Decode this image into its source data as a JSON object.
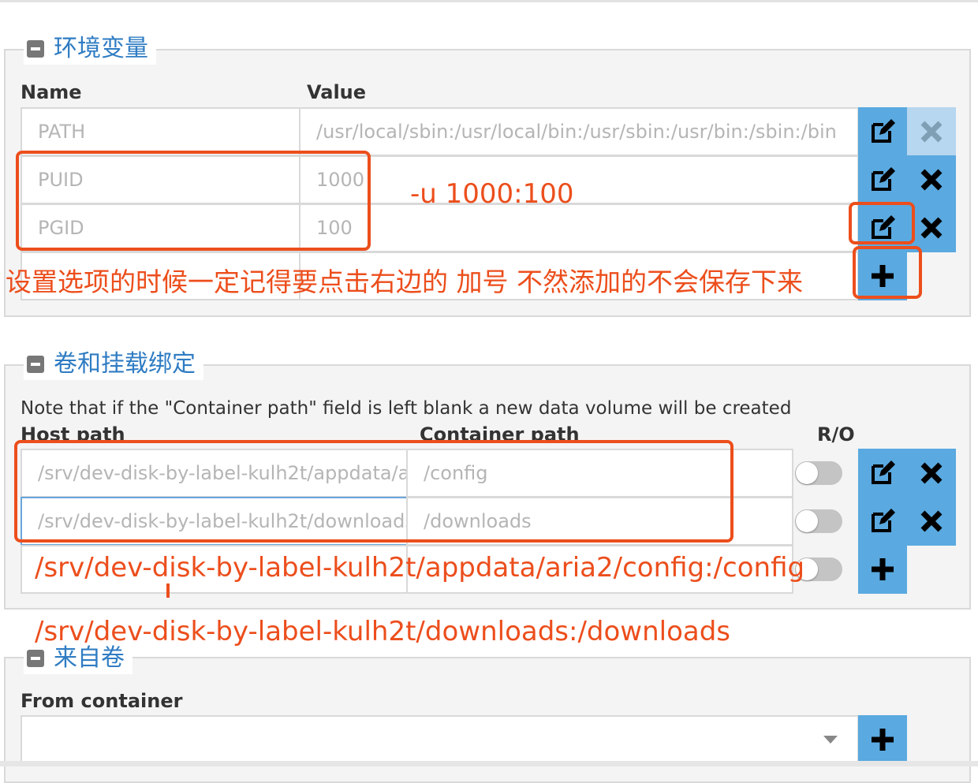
{
  "env_section": {
    "legend": "环境变量",
    "col_name": "Name",
    "col_value": "Value",
    "rows": [
      {
        "name": "PATH",
        "value": "/usr/local/sbin:/usr/local/bin:/usr/sbin:/usr/bin:/sbin:/bin"
      },
      {
        "name": "PUID",
        "value": "1000"
      },
      {
        "name": "PGID",
        "value": "100"
      }
    ]
  },
  "volumes_section": {
    "legend": "卷和挂载绑定",
    "note": "Note that if the \"Container path\" field is left blank a new data volume will be created",
    "col_host": "Host path",
    "col_container": "Container path",
    "col_ro": "R/O",
    "rows": [
      {
        "host": "/srv/dev-disk-by-label-kulh2t/appdata/aria2/config",
        "container": "/config"
      },
      {
        "host": "/srv/dev-disk-by-label-kulh2t/downloads",
        "container": "/downloads"
      }
    ]
  },
  "from_volumes_section": {
    "legend": "来自卷",
    "col_from": "From container",
    "select_value": ""
  },
  "annotations": {
    "uid_gid": "-u 1000:100",
    "save_hint": "设置选项的时候一定记得要点击右边的 加号 不然添加的不会保存下来",
    "config_mapping": "/srv/dev-disk-by-label-kulh2t/appdata/aria2/config:/config",
    "downloads_mapping": "/srv/dev-disk-by-label-kulh2t/downloads:/downloads"
  },
  "icons": {
    "edit": "edit-icon",
    "delete": "close-icon",
    "add": "plus-icon",
    "collapse": "minus-square-icon",
    "select": "chevron-down-icon"
  },
  "colors": {
    "accent": "#5aa9e0",
    "legend": "#2f7cc3",
    "annotation": "#ec4e1c"
  }
}
